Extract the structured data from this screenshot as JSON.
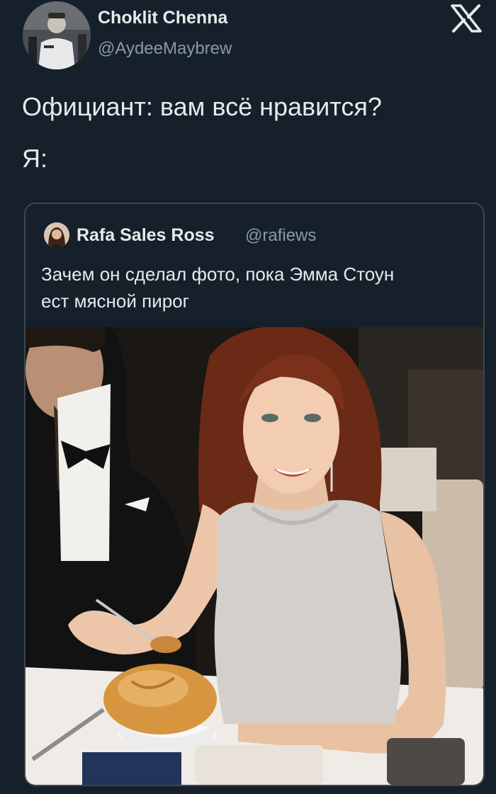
{
  "author": {
    "display_name": "Choklit Chenna",
    "handle": "@AydeeMaybrew",
    "avatar_icon": "user-avatar-photo"
  },
  "brand_icon": "x-logo-icon",
  "tweet": {
    "lines": [
      "Официант: вам всё нравится?",
      "Я:"
    ]
  },
  "quoted_tweet": {
    "display_name": "Rafa Sales Ross",
    "handle": "@rafiews",
    "text_lines": [
      "Зачем он сделал фото, пока Эмма Стоун",
      "ест мясной пирог"
    ],
    "media_icon": "photo-woman-eating-meat-pie"
  },
  "colors": {
    "background": "#15202b",
    "primary_text": "#e7e9ea",
    "secondary_text": "#8b98a5",
    "card_border": "#3c4651"
  }
}
